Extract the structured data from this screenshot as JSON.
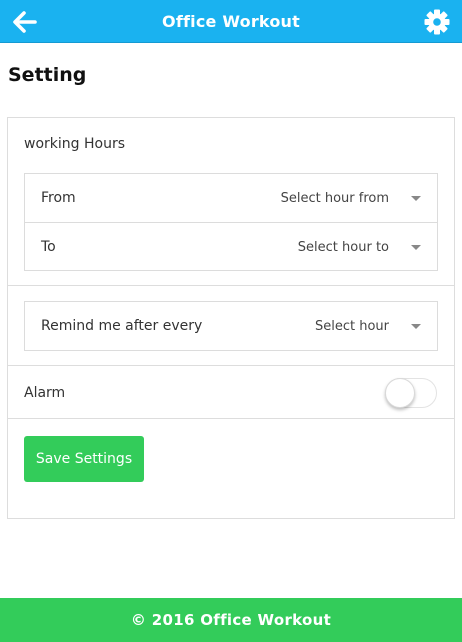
{
  "header": {
    "title": "Office Workout",
    "back_icon": "arrow-left-icon",
    "settings_icon": "gear-icon",
    "bg_color": "#1ab2f0"
  },
  "page": {
    "title": "Setting"
  },
  "working_hours": {
    "label": "working Hours",
    "from_label": "From",
    "from_select": "Select hour from",
    "to_label": "To",
    "to_select": "Select hour to"
  },
  "reminder": {
    "label": "Remind me after every",
    "select": "Select hour"
  },
  "alarm": {
    "label": "Alarm",
    "enabled": false
  },
  "save_button": {
    "label": "Save Settings",
    "color": "#33cc5a"
  },
  "footer": {
    "text": "© 2016 Office Workout",
    "color": "#33cc5a"
  }
}
